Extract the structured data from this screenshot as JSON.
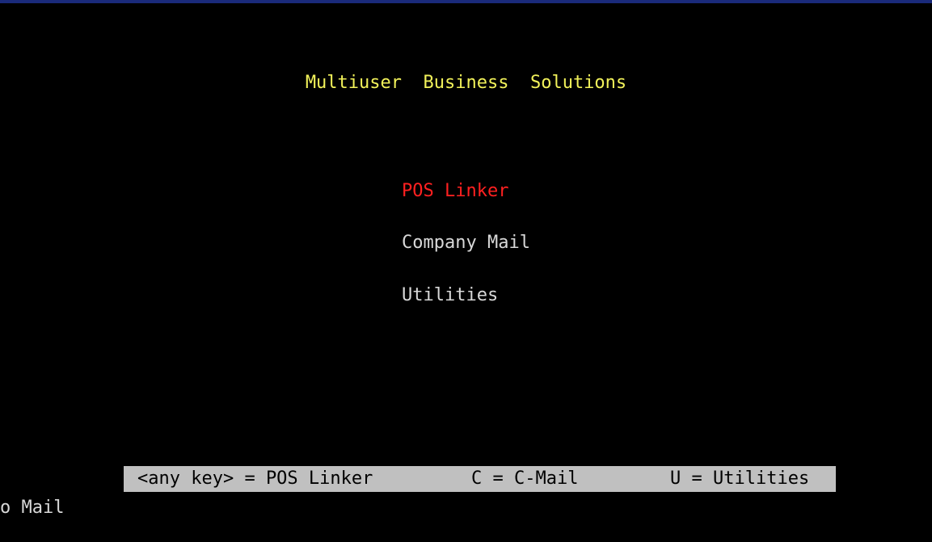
{
  "title": "Multiuser  Business  Solutions",
  "menu": {
    "items": [
      {
        "label": "POS Linker",
        "color": "#ff2020",
        "selected": true
      },
      {
        "label": "Company Mail",
        "color": "#d8d8d8",
        "selected": false
      },
      {
        "label": "Utilities",
        "color": "#d8d8d8",
        "selected": false
      }
    ]
  },
  "status_bar": {
    "any_key": "<any key> = POS Linker",
    "c_key": "C = C-Mail",
    "u_key": "U = Utilities"
  },
  "bottom_fragment": "o Mail",
  "colors": {
    "background": "#000000",
    "title": "#f2f25a",
    "selected": "#ff2020",
    "normal": "#d8d8d8",
    "status_bar_bg": "#c0c0c0"
  }
}
